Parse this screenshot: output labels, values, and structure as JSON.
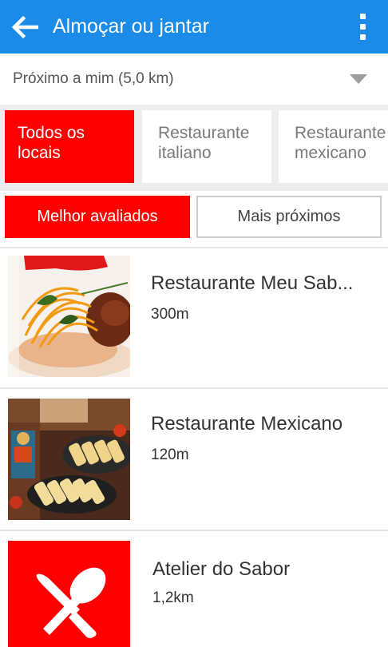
{
  "header": {
    "title": "Almoçar ou jantar",
    "back_icon": "arrow-left-icon",
    "more_icon": "more-vert-icon"
  },
  "location": {
    "label": "Próximo a mim (5,0 km)",
    "dropdown_icon": "caret-down-icon"
  },
  "categories": [
    {
      "label_line1": "Todos os",
      "label_line2": "locais",
      "active": true
    },
    {
      "label_line1": "Restaurante",
      "label_line2": "italiano",
      "active": false
    },
    {
      "label_line1": "Restaurante",
      "label_line2": "mexicano",
      "active": false
    }
  ],
  "sort": {
    "best_rated": "Melhor avaliados",
    "nearest": "Mais próximos"
  },
  "restaurants": [
    {
      "name": "Restaurante Meu Sab...",
      "distance": "300m",
      "image": "pasta-dish-photo"
    },
    {
      "name": "Restaurante Mexicano",
      "distance": "120m",
      "image": "mexican-buffet-photo"
    },
    {
      "name": "Atelier do Sabor",
      "distance": "1,2km",
      "image": "knife-spoon-icon"
    }
  ],
  "colors": {
    "primary": "#1a8be8",
    "accent": "#ff0000",
    "background_gray": "#ededed"
  }
}
